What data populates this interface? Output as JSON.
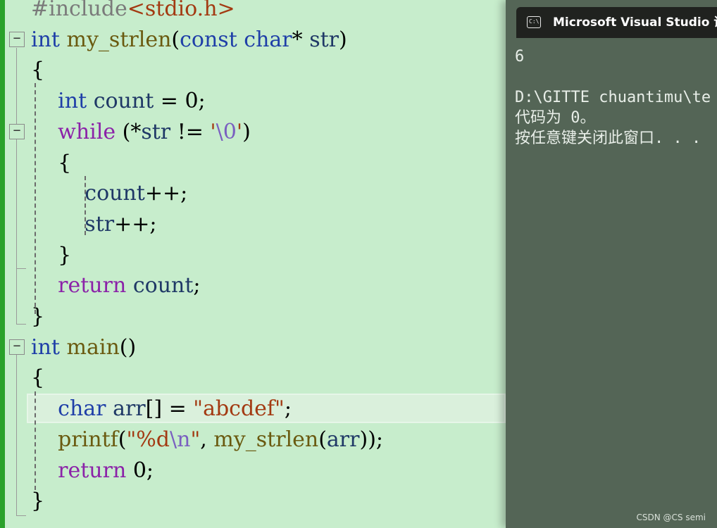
{
  "editor": {
    "lines": [
      [
        {
          "c": "pp",
          "t": "#include"
        },
        {
          "c": "hdr",
          "t": "<stdio.h>"
        }
      ],
      [
        {
          "c": "kw",
          "t": "int"
        },
        {
          "c": "op",
          "t": " "
        },
        {
          "c": "fn",
          "t": "my_strlen"
        },
        {
          "c": "op",
          "t": "("
        },
        {
          "c": "kw",
          "t": "const"
        },
        {
          "c": "op",
          "t": " "
        },
        {
          "c": "kw",
          "t": "char"
        },
        {
          "c": "op",
          "t": "* "
        },
        {
          "c": "id",
          "t": "str"
        },
        {
          "c": "op",
          "t": ")"
        }
      ],
      [
        {
          "c": "op",
          "t": "{"
        }
      ],
      [
        {
          "c": "op",
          "t": "    "
        },
        {
          "c": "kw",
          "t": "int"
        },
        {
          "c": "op",
          "t": " "
        },
        {
          "c": "id",
          "t": "count"
        },
        {
          "c": "op",
          "t": " = 0;"
        }
      ],
      [
        {
          "c": "op",
          "t": "    "
        },
        {
          "c": "ctl",
          "t": "while"
        },
        {
          "c": "op",
          "t": " (*"
        },
        {
          "c": "id",
          "t": "str"
        },
        {
          "c": "op",
          "t": " != "
        },
        {
          "c": "str",
          "t": "'"
        },
        {
          "c": "esc",
          "t": "\\0"
        },
        {
          "c": "str",
          "t": "'"
        },
        {
          "c": "op",
          "t": ")"
        }
      ],
      [
        {
          "c": "op",
          "t": "    {"
        }
      ],
      [
        {
          "c": "op",
          "t": "        "
        },
        {
          "c": "id",
          "t": "count"
        },
        {
          "c": "op",
          "t": "++;"
        }
      ],
      [
        {
          "c": "op",
          "t": "        "
        },
        {
          "c": "id",
          "t": "str"
        },
        {
          "c": "op",
          "t": "++;"
        }
      ],
      [
        {
          "c": "op",
          "t": "    }"
        }
      ],
      [
        {
          "c": "op",
          "t": "    "
        },
        {
          "c": "ctl",
          "t": "return"
        },
        {
          "c": "op",
          "t": " "
        },
        {
          "c": "id",
          "t": "count"
        },
        {
          "c": "op",
          "t": ";"
        }
      ],
      [
        {
          "c": "op",
          "t": "}"
        }
      ],
      [
        {
          "c": "kw",
          "t": "int"
        },
        {
          "c": "op",
          "t": " "
        },
        {
          "c": "fn",
          "t": "main"
        },
        {
          "c": "op",
          "t": "()"
        }
      ],
      [
        {
          "c": "op",
          "t": "{"
        }
      ],
      [
        {
          "c": "op",
          "t": "    "
        },
        {
          "c": "kw",
          "t": "char"
        },
        {
          "c": "op",
          "t": " "
        },
        {
          "c": "id",
          "t": "arr"
        },
        {
          "c": "op",
          "t": "[] = "
        },
        {
          "c": "str",
          "t": "\"abcdef\""
        },
        {
          "c": "op",
          "t": ";"
        }
      ],
      [
        {
          "c": "op",
          "t": "    "
        },
        {
          "c": "fn",
          "t": "printf"
        },
        {
          "c": "op",
          "t": "("
        },
        {
          "c": "str",
          "t": "\"%d"
        },
        {
          "c": "esc",
          "t": "\\n"
        },
        {
          "c": "str",
          "t": "\""
        },
        {
          "c": "op",
          "t": ", "
        },
        {
          "c": "fn",
          "t": "my_strlen"
        },
        {
          "c": "op",
          "t": "("
        },
        {
          "c": "id",
          "t": "arr"
        },
        {
          "c": "op",
          "t": "));"
        }
      ],
      [
        {
          "c": "op",
          "t": "    "
        },
        {
          "c": "ctl",
          "t": "return"
        },
        {
          "c": "op",
          "t": " 0;"
        }
      ],
      [
        {
          "c": "op",
          "t": "}"
        }
      ]
    ],
    "fold_glyph": "−"
  },
  "console": {
    "title": "Microsoft Visual Studio 调试",
    "icon_text": "C:\\",
    "output": [
      "6",
      "",
      "D:\\GITTE chuantimu\\te",
      "代码为 0。",
      "按任意键关闭此窗口. . ."
    ]
  },
  "watermark": "CSDN @CS semi",
  "colors": {
    "background": "#c7edcc",
    "keyword": "#1f3fa8",
    "control": "#8b22a8",
    "string": "#a33a12",
    "console_bg": "#546556",
    "titlebar_bg": "#20221f",
    "change_bar": "#2aa12a"
  }
}
